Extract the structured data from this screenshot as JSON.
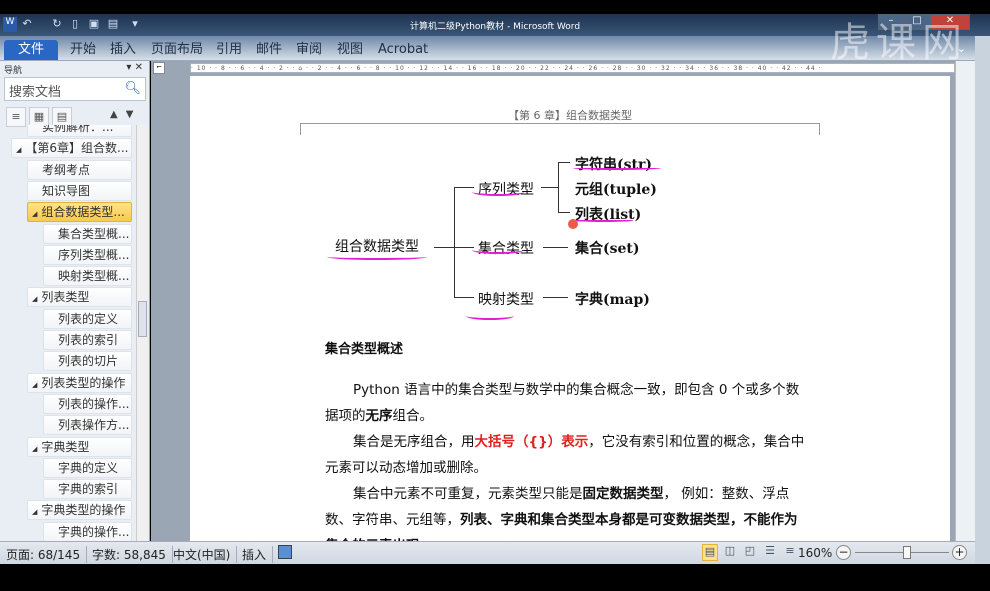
{
  "window": {
    "title": "计算机二级Python教材 - Microsoft Word",
    "watermark": "虎课网"
  },
  "ribbon": {
    "tabs": [
      "文件",
      "开始",
      "插入",
      "页面布局",
      "引用",
      "邮件",
      "审阅",
      "视图",
      "Acrobat"
    ]
  },
  "nav": {
    "header": "导航",
    "search_placeholder": "搜索文档",
    "items": [
      {
        "label": "实例解析：...",
        "level": 2
      },
      {
        "label": "【第6章】组合数...",
        "level": 1,
        "expanded": true
      },
      {
        "label": "考纲考点",
        "level": 2
      },
      {
        "label": "知识导图",
        "level": 2
      },
      {
        "label": "组合数据类型...",
        "level": 2,
        "expanded": true,
        "selected": true
      },
      {
        "label": "集合类型概...",
        "level": 3
      },
      {
        "label": "序列类型概...",
        "level": 3
      },
      {
        "label": "映射类型概...",
        "level": 3
      },
      {
        "label": "列表类型",
        "level": 2,
        "expanded": true
      },
      {
        "label": "列表的定义",
        "level": 3
      },
      {
        "label": "列表的索引",
        "level": 3
      },
      {
        "label": "列表的切片",
        "level": 3
      },
      {
        "label": "列表类型的操作",
        "level": 2,
        "expanded": true
      },
      {
        "label": "列表的操作...",
        "level": 3
      },
      {
        "label": "列表操作方...",
        "level": 3
      },
      {
        "label": "字典类型",
        "level": 2,
        "expanded": true
      },
      {
        "label": "字典的定义",
        "level": 3
      },
      {
        "label": "字典的索引",
        "level": 3
      },
      {
        "label": "字典类型的操作",
        "level": 2,
        "expanded": true
      },
      {
        "label": "字典的操作...",
        "level": 3
      }
    ]
  },
  "document": {
    "header": "【第 6 章】组合数据类型",
    "diagram": {
      "root": "组合数据类型",
      "seq": "序列类型",
      "set": "集合类型",
      "map": "映射类型",
      "str": "字符串(str)",
      "tuple": "元组(tuple)",
      "list": "列表(list)",
      "setv": "集合(set)",
      "dict": "字典(map)"
    },
    "section_title": "集合类型概述",
    "p1": {
      "a": "Python 语言中的集合类型与数学中的集合概念一致，即包含 0 个或多个数据项的",
      "b": "无序",
      "c": "组合。"
    },
    "p2": {
      "a": "集合是无序组合，用",
      "b": "大括号（{}）表示",
      "c": "，它没有索引和位置的概念，集合中元素可以动态增加或删除。"
    },
    "p3": {
      "a": "集合中元素不可重复，元素类型只能是",
      "b": "固定数据类型",
      "c": "， 例如：整数、浮点数、字符串、元组等，",
      "d": "列表、字典和集合类型本身都是可变数据类型",
      "e": "，不能作为集合的元素出现。"
    }
  },
  "status": {
    "page": "页面: 68/145",
    "words": "字数: 58,845",
    "lang": "中文(中国)",
    "mode": "插入",
    "zoom": "160%",
    "zoom_percent": 160
  }
}
